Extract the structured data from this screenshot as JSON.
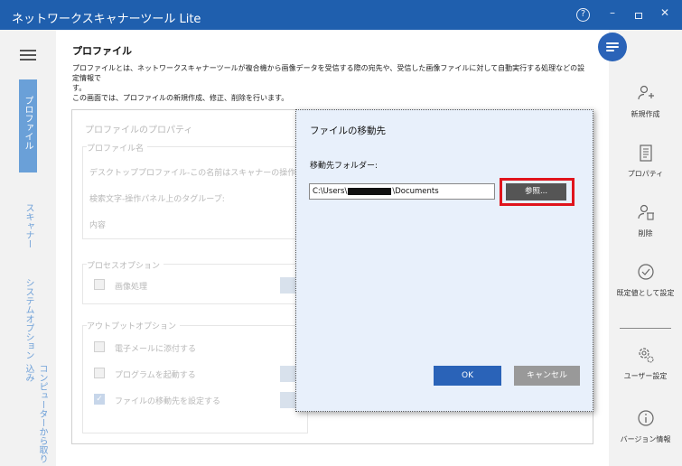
{
  "window": {
    "title": "ネットワークスキャナーツール Lite",
    "controls": {
      "help": "?",
      "minimize": "–",
      "close": "✕"
    }
  },
  "left_nav": {
    "tabs": [
      {
        "label": "プロファイル",
        "active": true
      },
      {
        "label": "スキャナー",
        "active": false
      },
      {
        "label": "システムオプション",
        "active": false
      },
      {
        "label": "コンピューターから取り込み",
        "active": false
      }
    ]
  },
  "content": {
    "title": "プロファイル",
    "description_line1": "プロファイルとは、ネットワークスキャナーツールが複合機から画像データを受信する際の宛先や、受信した画像ファイルに対して自動実行する処理などの設定情報で",
    "description_line2": "す。",
    "description_line3": "この画面では、プロファイルの新規作成、修正、削除を行います。"
  },
  "properties_panel": {
    "title": "プロファイルのプロパティ",
    "name_section": "プロファイル名",
    "name_value": "デスクトッププロファイル-この名前はスキャナーの操作パネルに表示さ",
    "search_label": "検索文字-操作パネル上のタグループ:",
    "content_label": "内容",
    "process_section": "プロセスオプション",
    "image_processing": "画像処理",
    "output_section": "アウトプットオプション",
    "attach_email": "電子メールに添付する",
    "launch_program": "プログラムを起動する",
    "set_destination": "ファイルの移動先を設定する"
  },
  "right_nav": {
    "items": [
      {
        "label": "新規作成",
        "icon": "add-user-icon"
      },
      {
        "label": "プロパティ",
        "icon": "properties-icon"
      },
      {
        "label": "削除",
        "icon": "delete-user-icon"
      },
      {
        "label": "既定値として設定",
        "icon": "checkmark-circle-icon"
      },
      {
        "label": "ユーザー設定",
        "icon": "gear-icon"
      },
      {
        "label": "バージョン情報",
        "icon": "info-icon"
      }
    ]
  },
  "dialog": {
    "title": "ファイルの移動先",
    "folder_label": "移動先フォルダー:",
    "path_prefix": "C:\\Users\\",
    "path_suffix": "\\Documents",
    "browse_label": "参照...",
    "ok_label": "OK",
    "cancel_label": "キャンセル"
  },
  "colors": {
    "titlebar": "#1f5fae",
    "accent": "#2a63b8",
    "highlight_border": "#e0141c",
    "dialog_bg": "#e8f0fb"
  }
}
